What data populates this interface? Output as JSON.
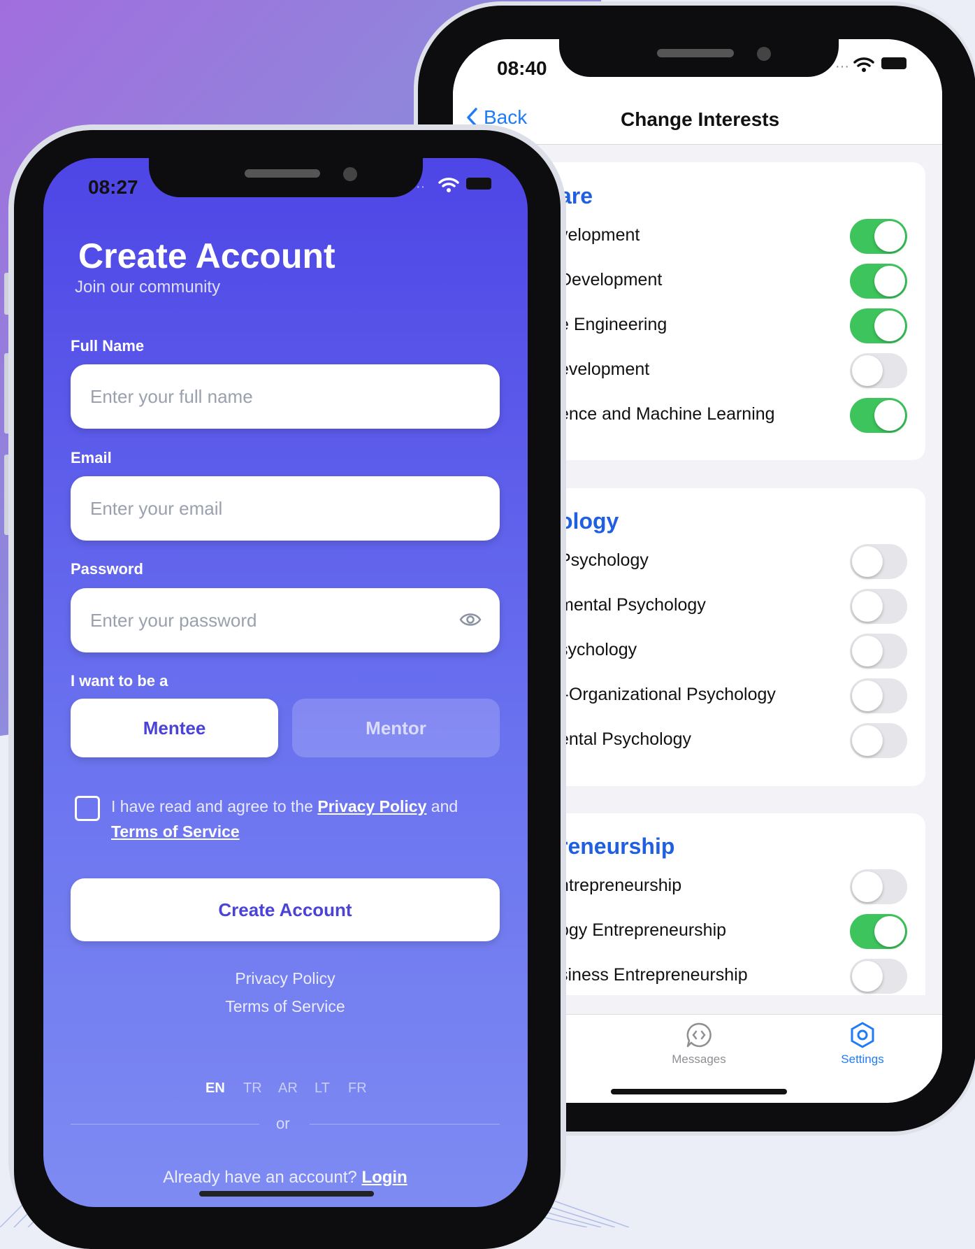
{
  "colors": {
    "accent_blue": "#1f7cf6",
    "section_blue": "#1f5fe0",
    "toggle_on": "#3dc45c",
    "toggle_off": "#e5e5ea",
    "create_gradient_top": "#4e45e6",
    "create_gradient_bottom": "#7e8bf2"
  },
  "back_phone": {
    "time": "08:40",
    "nav": {
      "back_label": "Back",
      "title": "Change Interests"
    },
    "sections": [
      {
        "title": "are",
        "items": [
          {
            "label": "velopment",
            "enabled": true
          },
          {
            "label": "Development",
            "enabled": true
          },
          {
            "label": "e Engineering",
            "enabled": true
          },
          {
            "label": "evelopment",
            "enabled": false
          },
          {
            "label": "ence and Machine Learning",
            "enabled": true
          }
        ]
      },
      {
        "title": "ology",
        "items": [
          {
            "label": "Psychology",
            "enabled": false
          },
          {
            "label": "mental Psychology",
            "enabled": false
          },
          {
            "label": "sychology",
            "enabled": false
          },
          {
            "label": "l-Organizational Psychology",
            "enabled": false
          },
          {
            "label": "ental Psychology",
            "enabled": false
          }
        ]
      },
      {
        "title": "reneurship",
        "items": [
          {
            "label": "ntrepreneurship",
            "enabled": false
          },
          {
            "label": "ogy Entrepreneurship",
            "enabled": true
          },
          {
            "label": "siness Entrepreneurship",
            "enabled": false
          }
        ]
      }
    ],
    "tabs": [
      {
        "label": "Messages",
        "icon": "message-bubble-icon",
        "active": false
      },
      {
        "label": "Settings",
        "icon": "settings-hexagon-icon",
        "active": true
      }
    ]
  },
  "front_phone": {
    "time": "08:27",
    "header": {
      "title": "Create Account",
      "subtitle": "Join our community"
    },
    "fields": {
      "full_name": {
        "label": "Full Name",
        "placeholder": "Enter your full name"
      },
      "email": {
        "label": "Email",
        "placeholder": "Enter your email"
      },
      "password": {
        "label": "Password",
        "placeholder": "Enter your password"
      }
    },
    "role": {
      "label": "I want to be a",
      "options": [
        "Mentee",
        "Mentor"
      ],
      "selected": "Mentee"
    },
    "agreement": {
      "prefix": "I have read and agree to the",
      "privacy": "Privacy Policy",
      "middle": "and",
      "terms": "Terms of Service",
      "checked": false
    },
    "primary_button": "Create Account",
    "footer_links": [
      "Privacy Policy",
      "Terms of Service"
    ],
    "languages": [
      "EN",
      "TR",
      "AR",
      "LT",
      "FR"
    ],
    "active_language": "EN",
    "divider_text": "or",
    "login": {
      "prompt": "Already have an account?",
      "link": "Login"
    }
  }
}
